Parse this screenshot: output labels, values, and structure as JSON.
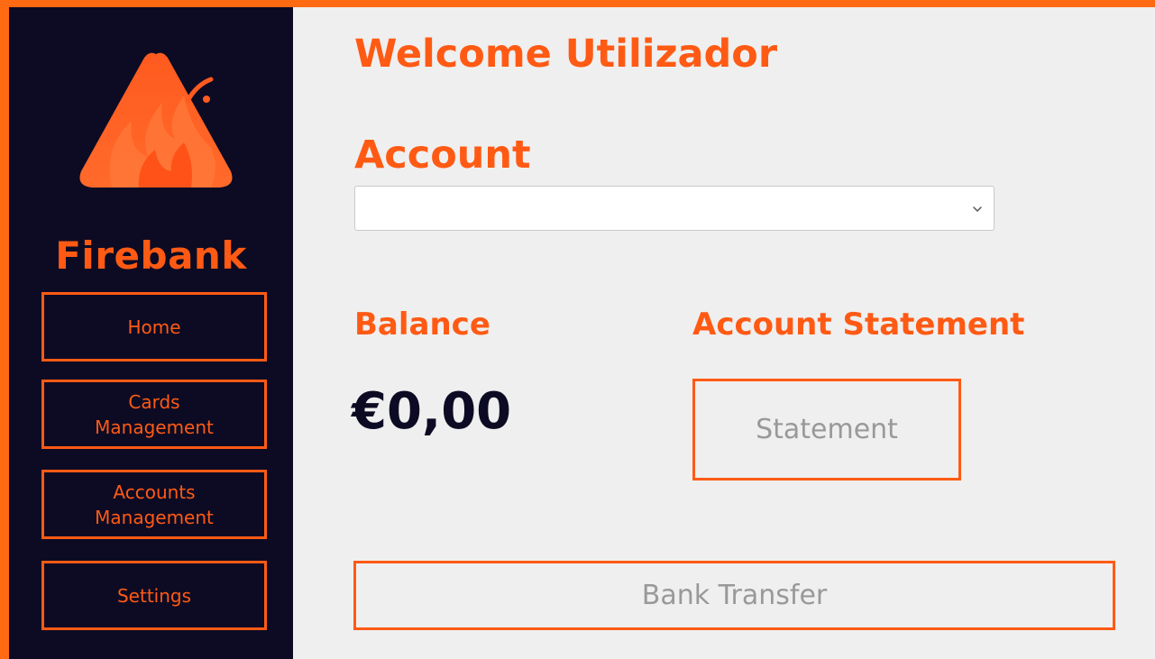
{
  "app": {
    "brand": "Firebank",
    "logo_icon": "flame-triangle-logo"
  },
  "colors": {
    "accent": "#ff5a14",
    "sidebar_bg": "#0d0b24",
    "content_bg": "#efefef",
    "muted_text": "#999999"
  },
  "sidebar": {
    "items": [
      {
        "label": "Home"
      },
      {
        "label": "Cards Management"
      },
      {
        "label": "Accounts Management"
      },
      {
        "label": "Settings"
      }
    ]
  },
  "main": {
    "welcome": "Welcome Utilizador",
    "account_label": "Account",
    "account_select": {
      "selected": "",
      "icon": "chevron-down-icon"
    },
    "balance_label": "Balance",
    "balance_value": "€0,00",
    "statement_label": "Account Statement",
    "statement_button": "Statement",
    "transfer_button": "Bank Transfer"
  }
}
